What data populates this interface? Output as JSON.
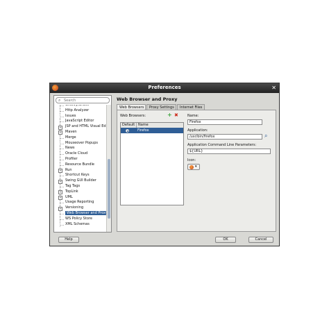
{
  "window": {
    "title": "Preferences"
  },
  "search": {
    "placeholder": "Search"
  },
  "tree": [
    {
      "label": "Groovy/Grails",
      "exp": "",
      "partial": true
    },
    {
      "label": "Http Analyzer",
      "exp": ""
    },
    {
      "label": "Issues",
      "exp": ""
    },
    {
      "label": "JavaScript Editor",
      "exp": ""
    },
    {
      "label": "JSP and HTML Visual Edit",
      "exp": "+"
    },
    {
      "label": "Maven",
      "exp": "+"
    },
    {
      "label": "Merge",
      "exp": ""
    },
    {
      "label": "Mouseover Popups",
      "exp": ""
    },
    {
      "label": "News",
      "exp": ""
    },
    {
      "label": "Oracle Cloud",
      "exp": ""
    },
    {
      "label": "Profiler",
      "exp": ""
    },
    {
      "label": "Resource Bundle",
      "exp": ""
    },
    {
      "label": "Run",
      "exp": "+"
    },
    {
      "label": "Shortcut Keys",
      "exp": ""
    },
    {
      "label": "Swing GUI Builder",
      "exp": "+"
    },
    {
      "label": "Tag Tags",
      "exp": ""
    },
    {
      "label": "TopLink",
      "exp": "+"
    },
    {
      "label": "UML",
      "exp": "+"
    },
    {
      "label": "Usage Reporting",
      "exp": ""
    },
    {
      "label": "Versioning",
      "exp": "+"
    },
    {
      "label": "Web Browser and Proxy",
      "exp": "",
      "selected": true
    },
    {
      "label": "WS Policy Store",
      "exp": ""
    },
    {
      "label": "XML Schemas",
      "exp": ""
    }
  ],
  "page": {
    "title": "Web Browser and Proxy"
  },
  "tabs": [
    "Web Browsers",
    "Proxy Settings",
    "Internet Files"
  ],
  "browsers": {
    "label": "Web Browsers:",
    "add": "+",
    "remove": "✖",
    "columns": [
      "Default",
      "Name"
    ],
    "rows": [
      {
        "name": "Firefox"
      }
    ]
  },
  "form": {
    "name_label": "Name:",
    "name_value": "Firefox",
    "app_label": "Application:",
    "app_value": "/usr/bin/firefox",
    "params_label": "Application Command Line Parameters:",
    "params_value": "${URL}",
    "icon_label": "Icon:"
  },
  "buttons": {
    "help": "Help",
    "ok": "OK",
    "cancel": "Cancel"
  },
  "colors": {
    "selection": "#2f5e96",
    "add": "#3aa33a",
    "remove": "#cc2a1a"
  }
}
